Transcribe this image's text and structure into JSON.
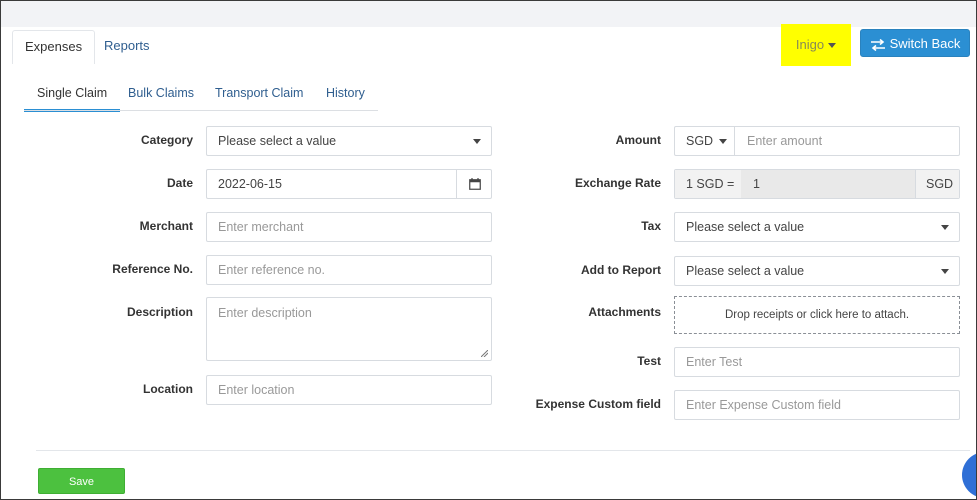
{
  "header": {
    "tabs": [
      {
        "label": "Expenses",
        "active": true
      },
      {
        "label": "Reports",
        "active": false
      }
    ],
    "user_menu": {
      "label": "Inigo",
      "highlight": "#ffff00"
    },
    "switch_back": {
      "label": "Switch Back",
      "icon": "swap-arrows-icon",
      "color": "#2b8fd3"
    }
  },
  "subtabs": [
    {
      "label": "Single Claim",
      "active": true
    },
    {
      "label": "Bulk Claims",
      "active": false
    },
    {
      "label": "Transport Claim",
      "active": false
    },
    {
      "label": "History",
      "active": false
    }
  ],
  "form": {
    "left": {
      "category": {
        "label": "Category",
        "placeholder": "Please select a value"
      },
      "date": {
        "label": "Date",
        "value": "2022-06-15"
      },
      "merchant": {
        "label": "Merchant",
        "placeholder": "Enter merchant"
      },
      "reference": {
        "label": "Reference No.",
        "placeholder": "Enter reference no."
      },
      "description": {
        "label": "Description",
        "placeholder": "Enter description"
      },
      "location": {
        "label": "Location",
        "placeholder": "Enter location"
      }
    },
    "right": {
      "amount": {
        "label": "Amount",
        "currency": "SGD",
        "placeholder": "Enter amount"
      },
      "exchange_rate": {
        "label": "Exchange Rate",
        "prefix": "1 SGD =",
        "value": "1",
        "suffix": "SGD"
      },
      "tax": {
        "label": "Tax",
        "placeholder": "Please select a value"
      },
      "add_to_report": {
        "label": "Add to Report",
        "placeholder": "Please select a value"
      },
      "attachments": {
        "label": "Attachments",
        "dropzone": "Drop receipts or click here to attach."
      },
      "test": {
        "label": "Test",
        "placeholder": "Enter Test"
      },
      "custom": {
        "label": "Expense Custom field",
        "placeholder": "Enter Expense Custom field"
      }
    }
  },
  "actions": {
    "save": "Save",
    "save_color": "#4cc13f"
  }
}
